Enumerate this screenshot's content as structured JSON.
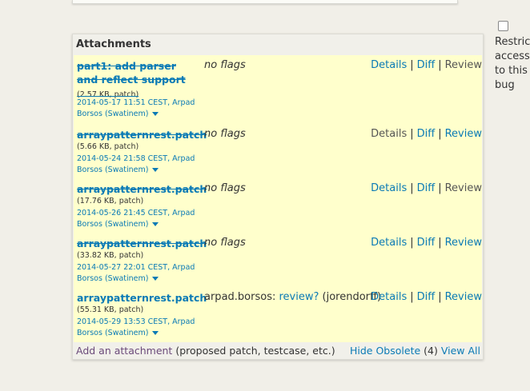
{
  "section_title": "Attachments",
  "attachments": [
    {
      "name": "part1: add parser and reflect support",
      "size": "(2.57 KB, patch)",
      "date": "2014-05-17 11:51 CEST, Arpad Borsos (Swatinem)",
      "flags": "no flags",
      "obsolete": true,
      "actions": [
        "Details",
        "Diff",
        "Review"
      ]
    },
    {
      "name": "arraypatternrest.patch",
      "size": "(5.66 KB, patch)",
      "date": "2014-05-24 21:58 CEST, Arpad Borsos (Swatinem)",
      "flags": "no flags",
      "obsolete": true,
      "actions": [
        "Details",
        "Diff",
        "Review"
      ]
    },
    {
      "name": "arraypatternrest.patch",
      "size": "(17.76 KB, patch)",
      "date": "2014-05-26 21:45 CEST, Arpad Borsos (Swatinem)",
      "flags": "no flags",
      "obsolete": true,
      "actions": [
        "Details",
        "Diff",
        "Review"
      ]
    },
    {
      "name": "arraypatternrest.patch",
      "size": "(33.82 KB, patch)",
      "date": "2014-05-27 22:01 CEST, Arpad Borsos (Swatinem)",
      "flags": "no flags",
      "obsolete": true,
      "actions": [
        "Details",
        "Diff",
        "Review"
      ]
    },
    {
      "name": "arraypatternrest.patch",
      "size": "(55.31 KB, patch)",
      "date": "2014-05-29 13:53 CEST, Arpad Borsos (Swatinem)",
      "flags_prefix": "arpad.borsos:",
      "flags_link": "review?",
      "flags_suffix": "(jorendorff)",
      "obsolete": false,
      "actions": [
        "Details",
        "Diff",
        "Review"
      ]
    }
  ],
  "footer": {
    "add_link": "Add an attachment",
    "add_hint": "(proposed patch, testcase, etc.)",
    "hide_obsolete": "Hide Obsolete",
    "obsolete_count": "(4)",
    "view_all": "View All"
  },
  "restrict": {
    "label": "Restrict access to this bug"
  },
  "icons": {
    "expand": "chevron-down-icon",
    "restrict_checkbox": "checkbox-icon"
  },
  "colors": {
    "link": "#0a7ab5",
    "visited_link": "#6b4a7a",
    "row_bg": "#ffffcc",
    "page_bg": "#f1efe8"
  }
}
